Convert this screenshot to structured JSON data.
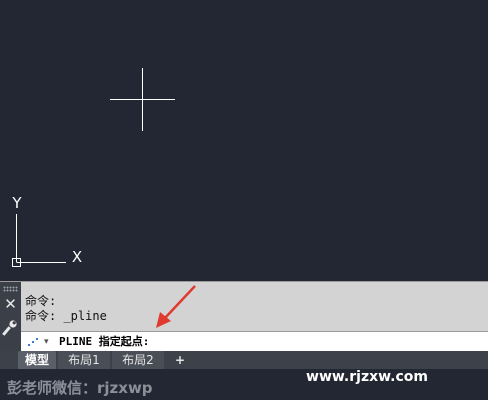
{
  "canvas": {
    "background_color": "#222733",
    "crosshair_color": "#ffffff",
    "ucs_icon": {
      "y_label": "Y",
      "x_label": "X"
    }
  },
  "command_line": {
    "history": [
      {
        "text": "命令:"
      },
      {
        "text": "命令: _pline"
      }
    ],
    "prompt_icon": "command-prompt-icon",
    "dropdown_icon": "▾",
    "prompt_text": "PLINE 指定起点:",
    "close_icon": "close-icon",
    "settings_icon": "wrench-icon"
  },
  "layout_tabs": [
    {
      "label": "模型",
      "active": true
    },
    {
      "label": "布局1",
      "active": false
    },
    {
      "label": "布局2",
      "active": false
    }
  ],
  "add_tab_label": "+",
  "annotation": {
    "arrow_color": "#e03a2f"
  },
  "footer": {
    "credit": "彭老师微信：rjzxwp",
    "site": "www.rjzxw.com"
  }
}
